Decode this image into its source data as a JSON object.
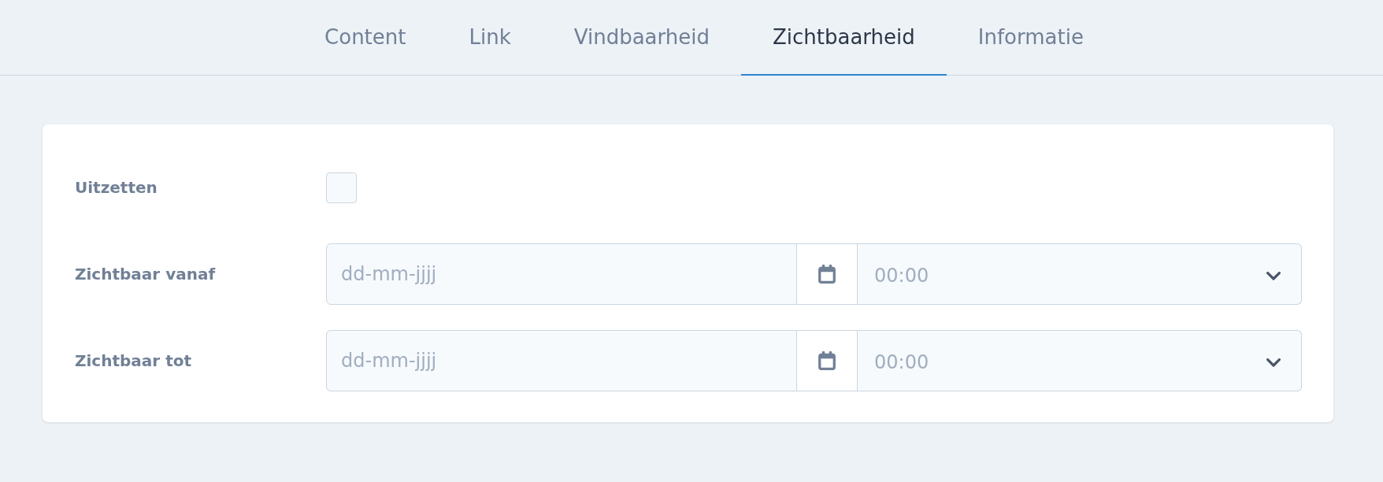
{
  "tabs": [
    {
      "label": "Content",
      "selected": false
    },
    {
      "label": "Link",
      "selected": false
    },
    {
      "label": "Vindbaarheid",
      "selected": false
    },
    {
      "label": "Zichtbaarheid",
      "selected": true
    },
    {
      "label": "Informatie",
      "selected": false
    }
  ],
  "form": {
    "fields": [
      {
        "kind": "checkbox",
        "label": "Uitzetten",
        "checked": false
      },
      {
        "kind": "datetime",
        "label": "Zichtbaar vanaf",
        "date": {
          "placeholder": "dd-mm-jjjj"
        },
        "time": {
          "placeholder": "00:00"
        }
      },
      {
        "kind": "datetime",
        "label": "Zichtbaar tot",
        "date": {
          "placeholder": "dd-mm-jjjj"
        },
        "time": {
          "placeholder": "00:00"
        }
      }
    ]
  }
}
